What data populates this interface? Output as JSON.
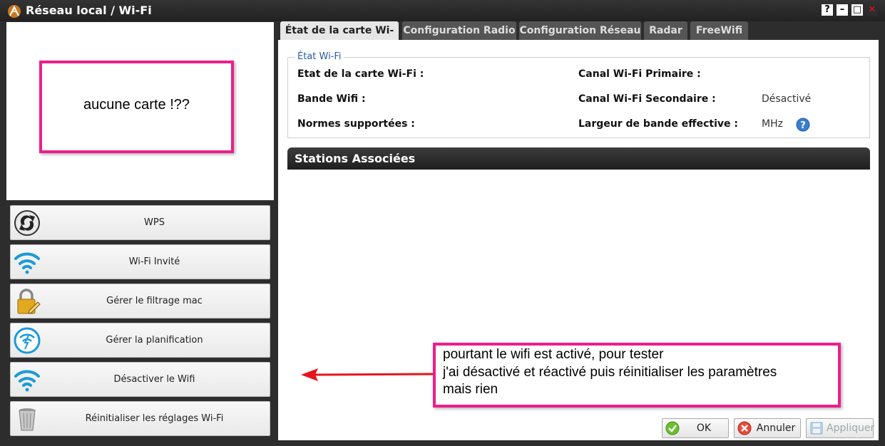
{
  "window": {
    "title": "Réseau local / Wi-Fi",
    "controls": [
      "?",
      "–",
      "□",
      "✕"
    ]
  },
  "preview_note": "aucune carte !??",
  "sidebar": {
    "items": [
      {
        "label": "WPS",
        "icon": "wps-icon"
      },
      {
        "label": "Wi-Fi Invité",
        "icon": "wifi-icon"
      },
      {
        "label": "Gérer le filtrage mac",
        "icon": "padlock-edit-icon"
      },
      {
        "label": "Gérer la planification",
        "icon": "wifi-clock-icon"
      },
      {
        "label": "Désactiver le Wifi",
        "icon": "wifi-icon"
      },
      {
        "label": "Réinitialiser les réglages Wi-Fi",
        "icon": "trash-icon"
      }
    ]
  },
  "tabs": [
    {
      "label": "État de la carte Wi-Fi",
      "active": true
    },
    {
      "label": "Configuration Radio",
      "active": false
    },
    {
      "label": "Configuration Réseau",
      "active": false
    },
    {
      "label": "Radar",
      "active": false
    },
    {
      "label": "FreeWifi",
      "active": false
    }
  ],
  "wifi_state": {
    "legend": "État Wi-Fi",
    "card_state_label": "Etat de la carte Wi-Fi :",
    "band_label": "Bande Wifi :",
    "norms_label": "Normes supportées :",
    "primary_channel_label": "Canal Wi-Fi Primaire :",
    "secondary_channel_label": "Canal Wi-Fi Secondaire :",
    "secondary_channel_value": "Désactivé",
    "bandwidth_label": "Largeur de bande effective :",
    "bandwidth_value": "MHz"
  },
  "stations": {
    "title": "Stations Associées"
  },
  "annotation": {
    "lines": [
      "pourtant le wifi est activé, pour tester",
      "j'ai désactivé et réactivé puis réinitialiser les paramètres",
      "mais rien"
    ]
  },
  "buttons": {
    "ok": "OK",
    "cancel": "Annuler",
    "apply": "Appliquer"
  },
  "colors": {
    "annotation_border": "#ec1e8c",
    "arrow": "#e8141c",
    "wifi_blue": "#1a9ad6",
    "legend_blue": "#2a5aa8"
  }
}
